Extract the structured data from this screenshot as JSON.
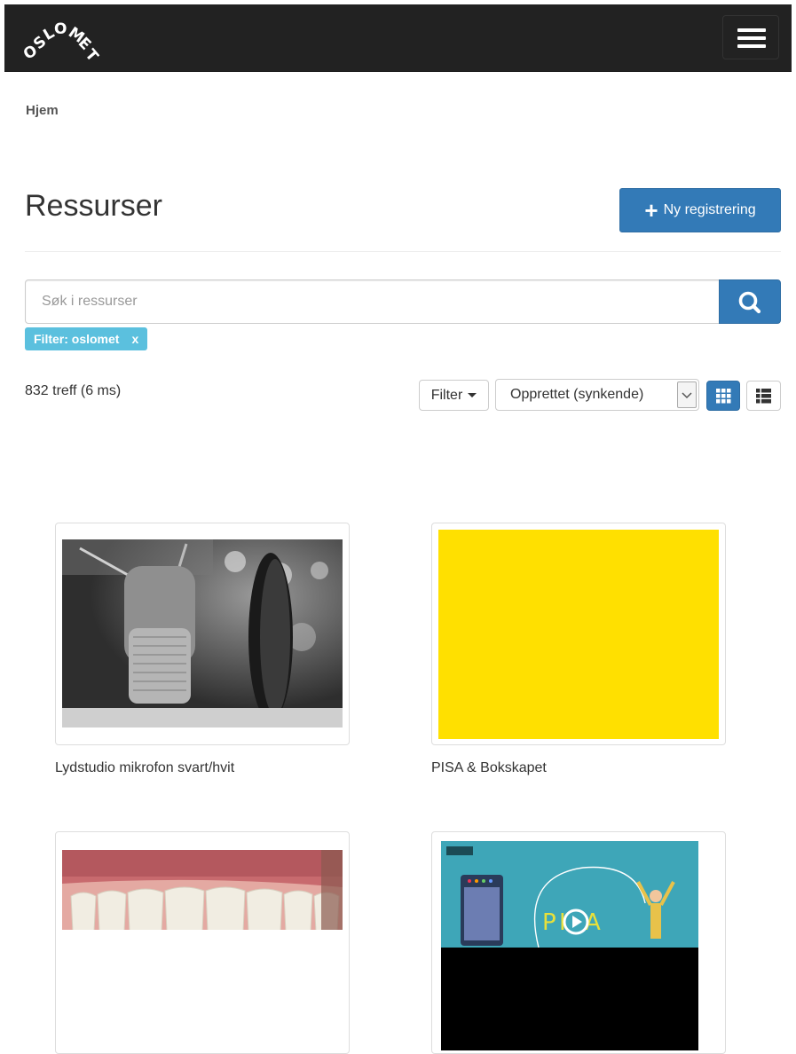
{
  "navbar": {
    "logo_text": "OSLOMET",
    "logo_icon": "oslomet-logo",
    "menu_icon": "hamburger-icon"
  },
  "breadcrumb": {
    "home": "Hjem"
  },
  "header": {
    "title": "Ressurser",
    "new_button_label": "Ny registrering",
    "new_button_icon": "plus-icon"
  },
  "search": {
    "placeholder": "Søk i ressurser",
    "value": "",
    "button_icon": "search-icon"
  },
  "active_filter": {
    "label": "Filter: oslomet",
    "remove": "x"
  },
  "results": {
    "count_text": "832 treff (6 ms)",
    "filter_button": "Filter",
    "sort_selected": "Opprettet (synkende)",
    "grid_view_icon": "grid-icon",
    "list_view_icon": "list-icon"
  },
  "items": [
    {
      "title": "Lydstudio mikrofon svart/hvit",
      "thumbnail": "microphone-photo"
    },
    {
      "title": "PISA & Bokskapet",
      "thumbnail": "yellow-square"
    },
    {
      "title": "",
      "thumbnail": "teeth-photo"
    },
    {
      "title": "",
      "thumbnail": "pisa-video-still"
    }
  ],
  "colors": {
    "navbar": "#222222",
    "primary": "#337ab7",
    "filter_tag": "#5bc0de",
    "yellow_thumb": "#ffe000",
    "video_bg": "#3ea6b8"
  }
}
